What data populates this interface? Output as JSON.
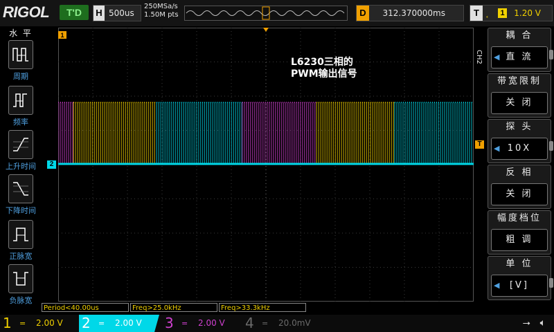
{
  "brand": "RIGOL",
  "status": "T'D",
  "horizontal": {
    "label": "H",
    "timebase": "500us"
  },
  "acquisition": {
    "sample_rate": "250MSa/s",
    "memory": "1.50M pts"
  },
  "delay": {
    "label": "D",
    "value": "312.370000ms"
  },
  "trigger": {
    "label": "T",
    "source": "1",
    "level": "1.20 V"
  },
  "left_menu": {
    "title": "水 平",
    "items": [
      {
        "label": "周期",
        "icon": "period-icon"
      },
      {
        "label": "频率",
        "icon": "frequency-icon"
      },
      {
        "label": "上升时间",
        "icon": "rise-time-icon"
      },
      {
        "label": "下降时间",
        "icon": "fall-time-icon"
      },
      {
        "label": "正脉宽",
        "icon": "positive-width-icon"
      },
      {
        "label": "负脉宽",
        "icon": "negative-width-icon"
      }
    ]
  },
  "annotation": {
    "line1": "L6230三相的",
    "line2": "PWM输出信号"
  },
  "markers": {
    "ch2_ground": "2",
    "trigger_level": "T"
  },
  "right_menu": {
    "channel_tag": "CH2",
    "items": [
      {
        "title": "耦 合",
        "value": "直 流"
      },
      {
        "title": "带宽限制",
        "value": "关 闭"
      },
      {
        "title": "探 头",
        "value": "10X"
      },
      {
        "title": "反 相",
        "value": "关 闭"
      },
      {
        "title": "幅度档位",
        "value": "粗 调"
      },
      {
        "title": "单 位",
        "value": "[V]"
      }
    ]
  },
  "measurements": [
    "Period<40.00us",
    "Freq>25.0kHz",
    "Freq>33.3kHz"
  ],
  "channels": [
    {
      "num": "1",
      "scale": "2.00 V",
      "color": "#f0d000"
    },
    {
      "num": "2",
      "scale": "2.00 V",
      "color": "#00d8e8"
    },
    {
      "num": "3",
      "scale": "2.00 V",
      "color": "#d040d0"
    },
    {
      "num": "4",
      "scale": "20.0mV",
      "color": "#6a6a6a"
    }
  ],
  "waveform": {
    "segments": [
      {
        "color": "#d040d0",
        "from": 0.0,
        "to": 0.037
      },
      {
        "color": "#f0d000",
        "from": 0.037,
        "to": 0.237
      },
      {
        "color": "#00d8e8",
        "from": 0.237,
        "to": 0.443
      },
      {
        "color": "#d040d0",
        "from": 0.443,
        "to": 0.622
      },
      {
        "color": "#f0d000",
        "from": 0.622,
        "to": 0.81
      },
      {
        "color": "#00d8e8",
        "from": 0.81,
        "to": 1.0
      }
    ]
  }
}
